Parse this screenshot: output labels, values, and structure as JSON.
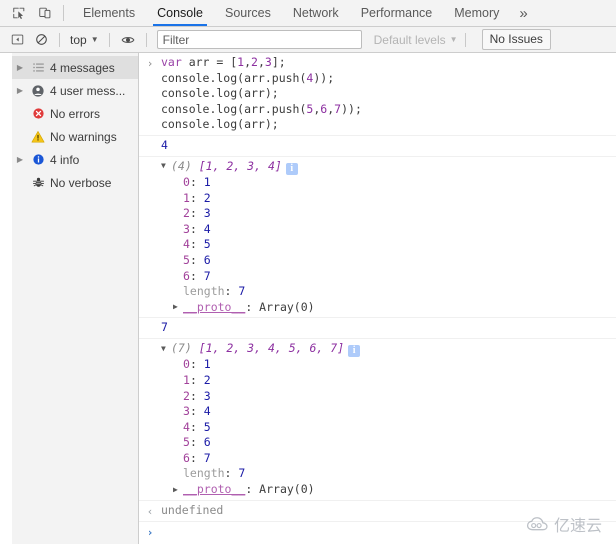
{
  "window": {
    "title": "Chrome DevTools Console"
  },
  "toolbar": {
    "inspect_icon": "inspect-element-icon",
    "device_icon": "device-toolbar-icon",
    "tabs": [
      {
        "label": "Elements",
        "active": false
      },
      {
        "label": "Console",
        "active": true
      },
      {
        "label": "Sources",
        "active": false
      },
      {
        "label": "Network",
        "active": false
      },
      {
        "label": "Performance",
        "active": false
      },
      {
        "label": "Memory",
        "active": false
      }
    ],
    "more_tabs_label": "»"
  },
  "filterbar": {
    "sidebar_toggle_icon": "show-console-sidebar-icon",
    "clear_icon": "clear-console-icon",
    "context_value": "top",
    "context_caret": "▼",
    "eye_icon": "live-expression-eye-icon",
    "filter_placeholder": "Filter",
    "filter_value": "",
    "levels_label": "Default levels",
    "levels_caret": "▼",
    "issues_label": "No Issues"
  },
  "sidebar": {
    "items": [
      {
        "label": "4 messages",
        "icon": "list-icon",
        "expandable": true,
        "selected": true
      },
      {
        "label": "4 user mess...",
        "icon": "person-icon",
        "expandable": true,
        "selected": false
      },
      {
        "label": "No errors",
        "icon": "error-icon",
        "expandable": false,
        "selected": false
      },
      {
        "label": "No warnings",
        "icon": "warning-icon",
        "expandable": false,
        "selected": false
      },
      {
        "label": "4 info",
        "icon": "info-icon",
        "expandable": true,
        "selected": false
      },
      {
        "label": "No verbose",
        "icon": "bug-icon",
        "expandable": false,
        "selected": false
      }
    ],
    "expand_triangle": "▶"
  },
  "console": {
    "input_marker": "›",
    "output_marker": "‹",
    "expanded_triangle": "▼",
    "collapsed_triangle": "▶",
    "info_badge": "i",
    "input_lines": [
      "var arr = [1,2,3];",
      "console.log(arr.push(4));",
      "console.log(arr);",
      "console.log(arr.push(5,6,7));",
      "console.log(arr);"
    ],
    "result_push4": "4",
    "result_push567": "7",
    "array1": {
      "prefix": "(4)",
      "preview": "[1, 2, 3, 4]",
      "properties": [
        {
          "key": "0",
          "value": "1"
        },
        {
          "key": "1",
          "value": "2"
        },
        {
          "key": "2",
          "value": "3"
        },
        {
          "key": "3",
          "value": "4"
        },
        {
          "key": "4",
          "value": "5"
        },
        {
          "key": "5",
          "value": "6"
        },
        {
          "key": "6",
          "value": "7"
        }
      ],
      "length_key": "length",
      "length_value": "7",
      "proto_key": "__proto__",
      "proto_value": "Array(0)"
    },
    "array2": {
      "prefix": "(7)",
      "preview": "[1, 2, 3, 4, 5, 6, 7]",
      "properties": [
        {
          "key": "0",
          "value": "1"
        },
        {
          "key": "1",
          "value": "2"
        },
        {
          "key": "2",
          "value": "3"
        },
        {
          "key": "3",
          "value": "4"
        },
        {
          "key": "4",
          "value": "5"
        },
        {
          "key": "5",
          "value": "6"
        },
        {
          "key": "6",
          "value": "7"
        }
      ],
      "length_key": "length",
      "length_value": "7",
      "proto_key": "__proto__",
      "proto_value": "Array(0)"
    },
    "undefined_result": "undefined",
    "prompt_value": ""
  },
  "watermark": {
    "text": "亿速云",
    "icon": "cloud-logo-icon"
  },
  "colors": {
    "accent": "#1a73e8",
    "error": "#dd3c3c",
    "warning": "#f2c124",
    "info": "#1a73e8",
    "toolbar_bg": "#f3f3f3",
    "sidebar_bg": "#f3f3f3",
    "selected_bg": "#dfdfdf"
  }
}
